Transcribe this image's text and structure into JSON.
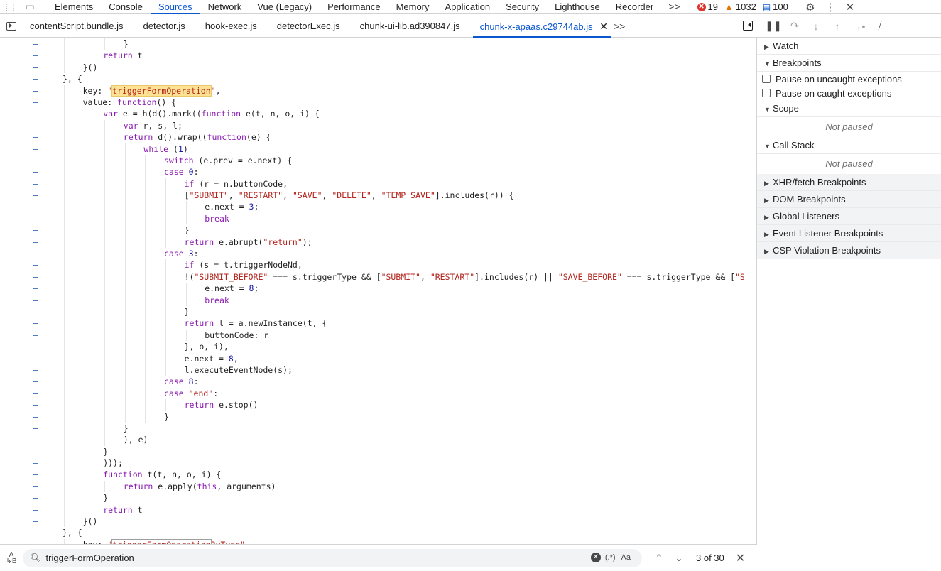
{
  "topbar": {
    "tabs": [
      "Elements",
      "Console",
      "Sources",
      "Network",
      "Vue (Legacy)",
      "Performance",
      "Memory",
      "Application",
      "Security",
      "Lighthouse",
      "Recorder"
    ],
    "active_tab": "Sources",
    "more": ">>",
    "errors": "19",
    "warnings": "1032",
    "messages": "100"
  },
  "filetabs": {
    "files": [
      "contentScript.bundle.js",
      "detector.js",
      "hook-exec.js",
      "detectorExec.js",
      "chunk-ui-lib.ad390847.js"
    ],
    "active_file": "chunk-x-apaas.c29744ab.js",
    "more": ">>"
  },
  "editor": {
    "lines": [
      {
        "indent": 3,
        "tokens": [
          {
            "t": "}"
          }
        ]
      },
      {
        "indent": 2,
        "tokens": [
          {
            "t": "return ",
            "c": "kw"
          },
          {
            "t": "t"
          }
        ]
      },
      {
        "indent": 1,
        "tokens": [
          {
            "t": "}()"
          }
        ]
      },
      {
        "indent": 0,
        "tokens": [
          {
            "t": "}, {"
          }
        ]
      },
      {
        "indent": 1,
        "tokens": [
          {
            "t": "key: "
          },
          {
            "t": "\"",
            "c": "str"
          },
          {
            "t": "triggerFormOperation",
            "c": "str hl"
          },
          {
            "t": "\"",
            "c": "str"
          },
          {
            "t": ","
          }
        ]
      },
      {
        "indent": 1,
        "tokens": [
          {
            "t": "value: "
          },
          {
            "t": "function",
            "c": "kw"
          },
          {
            "t": "() {"
          }
        ]
      },
      {
        "indent": 2,
        "tokens": [
          {
            "t": "var ",
            "c": "kw"
          },
          {
            "t": "e = h(d().mark(("
          },
          {
            "t": "function ",
            "c": "kw"
          },
          {
            "t": "e(t, n, o, i) {"
          }
        ]
      },
      {
        "indent": 3,
        "tokens": [
          {
            "t": "var ",
            "c": "kw"
          },
          {
            "t": "r, s, l;"
          }
        ]
      },
      {
        "indent": 3,
        "tokens": [
          {
            "t": "return ",
            "c": "kw"
          },
          {
            "t": "d().wrap(("
          },
          {
            "t": "function",
            "c": "kw"
          },
          {
            "t": "(e) {"
          }
        ]
      },
      {
        "indent": 4,
        "tokens": [
          {
            "t": "while ",
            "c": "kw"
          },
          {
            "t": "("
          },
          {
            "t": "1",
            "c": "num"
          },
          {
            "t": ")"
          }
        ]
      },
      {
        "indent": 5,
        "tokens": [
          {
            "t": "switch ",
            "c": "kw"
          },
          {
            "t": "(e.prev = e.next) {"
          }
        ]
      },
      {
        "indent": 5,
        "tokens": [
          {
            "t": "case ",
            "c": "kw"
          },
          {
            "t": "0",
            "c": "num"
          },
          {
            "t": ":"
          }
        ]
      },
      {
        "indent": 6,
        "tokens": [
          {
            "t": "if ",
            "c": "kw"
          },
          {
            "t": "(r = n.buttonCode,"
          }
        ]
      },
      {
        "indent": 6,
        "tokens": [
          {
            "t": "["
          },
          {
            "t": "\"SUBMIT\"",
            "c": "str"
          },
          {
            "t": ", "
          },
          {
            "t": "\"RESTART\"",
            "c": "str"
          },
          {
            "t": ", "
          },
          {
            "t": "\"SAVE\"",
            "c": "str"
          },
          {
            "t": ", "
          },
          {
            "t": "\"DELETE\"",
            "c": "str"
          },
          {
            "t": ", "
          },
          {
            "t": "\"TEMP_SAVE\"",
            "c": "str"
          },
          {
            "t": "].includes(r)) {"
          }
        ]
      },
      {
        "indent": 7,
        "tokens": [
          {
            "t": "e.next = "
          },
          {
            "t": "3",
            "c": "num"
          },
          {
            "t": ";"
          }
        ]
      },
      {
        "indent": 7,
        "tokens": [
          {
            "t": "break",
            "c": "kw"
          }
        ]
      },
      {
        "indent": 6,
        "tokens": [
          {
            "t": "}"
          }
        ]
      },
      {
        "indent": 6,
        "tokens": [
          {
            "t": "return ",
            "c": "kw"
          },
          {
            "t": "e.abrupt("
          },
          {
            "t": "\"return\"",
            "c": "str"
          },
          {
            "t": ");"
          }
        ]
      },
      {
        "indent": 5,
        "tokens": [
          {
            "t": "case ",
            "c": "kw"
          },
          {
            "t": "3",
            "c": "num"
          },
          {
            "t": ":"
          }
        ]
      },
      {
        "indent": 6,
        "tokens": [
          {
            "t": "if ",
            "c": "kw"
          },
          {
            "t": "(s = t.triggerNodeNd,"
          }
        ]
      },
      {
        "indent": 6,
        "tokens": [
          {
            "t": "!("
          },
          {
            "t": "\"SUBMIT_BEFORE\"",
            "c": "str"
          },
          {
            "t": " === s.triggerType && ["
          },
          {
            "t": "\"SUBMIT\"",
            "c": "str"
          },
          {
            "t": ", "
          },
          {
            "t": "\"RESTART\"",
            "c": "str"
          },
          {
            "t": "].includes(r) || "
          },
          {
            "t": "\"SAVE_BEFORE\"",
            "c": "str"
          },
          {
            "t": " === s.triggerType && ["
          },
          {
            "t": "\"S",
            "c": "str"
          }
        ]
      },
      {
        "indent": 7,
        "tokens": [
          {
            "t": "e.next = "
          },
          {
            "t": "8",
            "c": "num"
          },
          {
            "t": ";"
          }
        ]
      },
      {
        "indent": 7,
        "tokens": [
          {
            "t": "break",
            "c": "kw"
          }
        ]
      },
      {
        "indent": 6,
        "tokens": [
          {
            "t": "}"
          }
        ]
      },
      {
        "indent": 6,
        "tokens": [
          {
            "t": "return ",
            "c": "kw"
          },
          {
            "t": "l = a.newInstance(t, {"
          }
        ]
      },
      {
        "indent": 7,
        "tokens": [
          {
            "t": "buttonCode: r"
          }
        ]
      },
      {
        "indent": 6,
        "tokens": [
          {
            "t": "}, o, i),"
          }
        ]
      },
      {
        "indent": 6,
        "tokens": [
          {
            "t": "e.next = "
          },
          {
            "t": "8",
            "c": "num"
          },
          {
            "t": ","
          }
        ]
      },
      {
        "indent": 6,
        "tokens": [
          {
            "t": "l.executeEventNode(s);"
          }
        ]
      },
      {
        "indent": 5,
        "tokens": [
          {
            "t": "case ",
            "c": "kw"
          },
          {
            "t": "8",
            "c": "num"
          },
          {
            "t": ":"
          }
        ]
      },
      {
        "indent": 5,
        "tokens": [
          {
            "t": "case ",
            "c": "kw"
          },
          {
            "t": "\"end\"",
            "c": "str"
          },
          {
            "t": ":"
          }
        ]
      },
      {
        "indent": 6,
        "tokens": [
          {
            "t": "return ",
            "c": "kw"
          },
          {
            "t": "e.stop()"
          }
        ]
      },
      {
        "indent": 5,
        "tokens": [
          {
            "t": "}"
          }
        ]
      },
      {
        "indent": 3,
        "tokens": [
          {
            "t": "}"
          }
        ]
      },
      {
        "indent": 3,
        "tokens": [
          {
            "t": "), e)"
          }
        ]
      },
      {
        "indent": 2,
        "tokens": [
          {
            "t": "}"
          }
        ]
      },
      {
        "indent": 2,
        "tokens": [
          {
            "t": ")));"
          }
        ]
      },
      {
        "indent": 2,
        "tokens": [
          {
            "t": "function ",
            "c": "kw"
          },
          {
            "t": "t(t, n, o, i) {"
          }
        ]
      },
      {
        "indent": 3,
        "tokens": [
          {
            "t": "return ",
            "c": "kw"
          },
          {
            "t": "e.apply("
          },
          {
            "t": "this",
            "c": "kw"
          },
          {
            "t": ", arguments)"
          }
        ]
      },
      {
        "indent": 2,
        "tokens": [
          {
            "t": "}"
          }
        ]
      },
      {
        "indent": 2,
        "tokens": [
          {
            "t": "return ",
            "c": "kw"
          },
          {
            "t": "t"
          }
        ]
      },
      {
        "indent": 1,
        "tokens": [
          {
            "t": "}()"
          }
        ]
      },
      {
        "indent": 0,
        "tokens": [
          {
            "t": "}, {"
          }
        ]
      },
      {
        "indent": 1,
        "tokens": [
          {
            "t": "key: "
          },
          {
            "t": "\"",
            "c": "str"
          },
          {
            "t": "triggerFormOperation",
            "c": "str hl2"
          },
          {
            "t": "ByType\"",
            "c": "str"
          },
          {
            "t": ","
          }
        ]
      }
    ]
  },
  "search": {
    "query": "triggerFormOperation",
    "regex_label": "(.*)",
    "case_label": "Aa",
    "match_count": "3 of 30"
  },
  "sidebar": {
    "sections": [
      {
        "title": "Watch",
        "expanded": false
      },
      {
        "title": "Breakpoints",
        "expanded": true
      },
      {
        "title": "Scope",
        "expanded": true
      },
      {
        "title": "Call Stack",
        "expanded": true
      },
      {
        "title": "XHR/fetch Breakpoints",
        "expanded": false
      },
      {
        "title": "DOM Breakpoints",
        "expanded": false
      },
      {
        "title": "Global Listeners",
        "expanded": false
      },
      {
        "title": "Event Listener Breakpoints",
        "expanded": false
      },
      {
        "title": "CSP Violation Breakpoints",
        "expanded": false
      }
    ],
    "pause_uncaught": "Pause on uncaught exceptions",
    "pause_caught": "Pause on caught exceptions",
    "not_paused": "Not paused"
  }
}
